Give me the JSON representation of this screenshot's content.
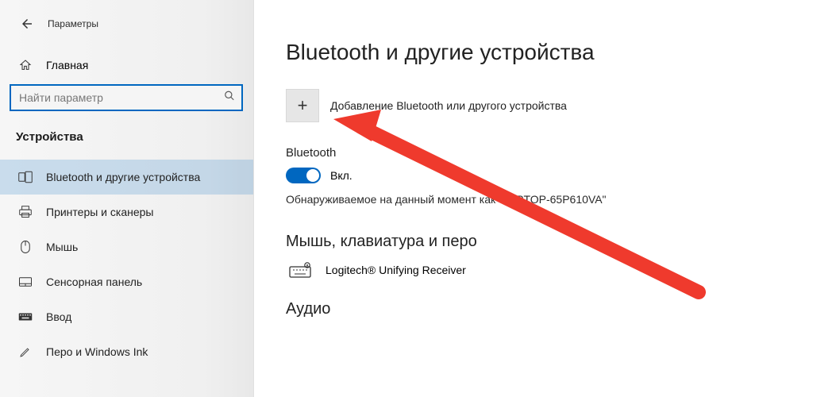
{
  "window": {
    "title": "Параметры"
  },
  "sidebar": {
    "home_label": "Главная",
    "search_placeholder": "Найти параметр",
    "section_title": "Устройства",
    "items": [
      {
        "label": "Bluetooth и другие устройства",
        "active": true
      },
      {
        "label": "Принтеры и сканеры",
        "active": false
      },
      {
        "label": "Мышь",
        "active": false
      },
      {
        "label": "Сенсорная панель",
        "active": false
      },
      {
        "label": "Ввод",
        "active": false
      },
      {
        "label": "Перо и Windows Ink",
        "active": false
      }
    ]
  },
  "main": {
    "page_title": "Bluetooth и другие устройства",
    "add_device_label": "Добавление Bluetooth или другого устройства",
    "bt_heading": "Bluetooth",
    "toggle_state_label": "Вкл.",
    "discoverable_text": "Обнаруживаемое на данный момент как \"LAPTOP-65P610VA\"",
    "mouse_section": "Мышь, клавиатура и перо",
    "device_1": "Logitech® Unifying Receiver",
    "audio_section": "Аудио"
  }
}
